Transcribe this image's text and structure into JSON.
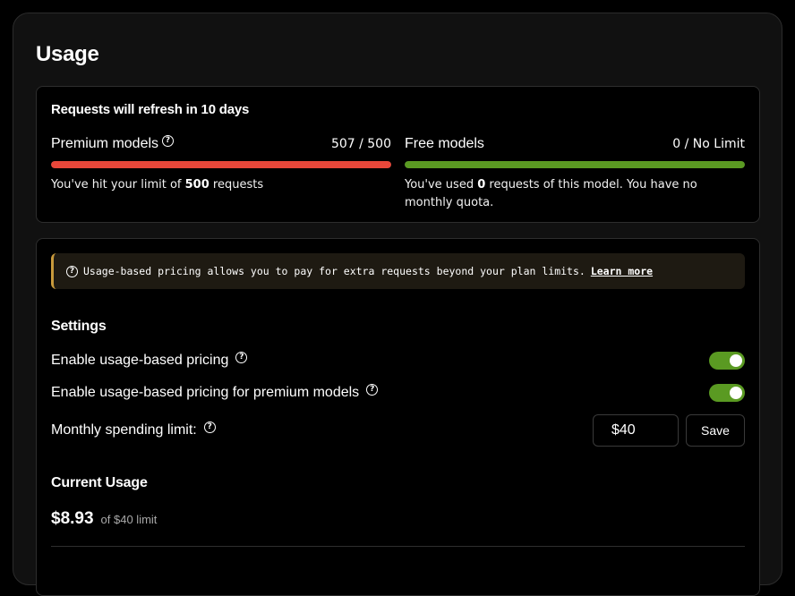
{
  "page": {
    "title": "Usage"
  },
  "limits": {
    "refresh_text": "Requests will refresh in 10 days",
    "premium": {
      "label": "Premium models",
      "count": "507 / 500",
      "progress": 1.0,
      "bar_color": "#e8473a",
      "note_prefix": "You've hit your limit of ",
      "note_value": "500",
      "note_suffix": " requests"
    },
    "free": {
      "label": "Free models",
      "count": "0 / No Limit",
      "progress": 1.0,
      "bar_color": "#5a9a22",
      "note_prefix": "You've used ",
      "note_value": "0",
      "note_suffix": " requests of this model. You have no monthly quota."
    }
  },
  "banner": {
    "text": "Usage-based pricing allows you to pay for extra requests beyond your plan limits.",
    "link_label": "Learn more"
  },
  "settings": {
    "title": "Settings",
    "usage_pricing_label": "Enable usage-based pricing",
    "usage_pricing_enabled": true,
    "premium_pricing_label": "Enable usage-based pricing for premium models",
    "premium_pricing_enabled": true,
    "spending_limit_label": "Monthly spending limit:",
    "spending_limit_value": "$40",
    "save_label": "Save"
  },
  "current_usage": {
    "title": "Current Usage",
    "amount": "$8.93",
    "limit_text": "of $40 limit"
  },
  "colors": {
    "toggle_on": "#5a9a22",
    "banner_accent": "#c89a3c"
  }
}
